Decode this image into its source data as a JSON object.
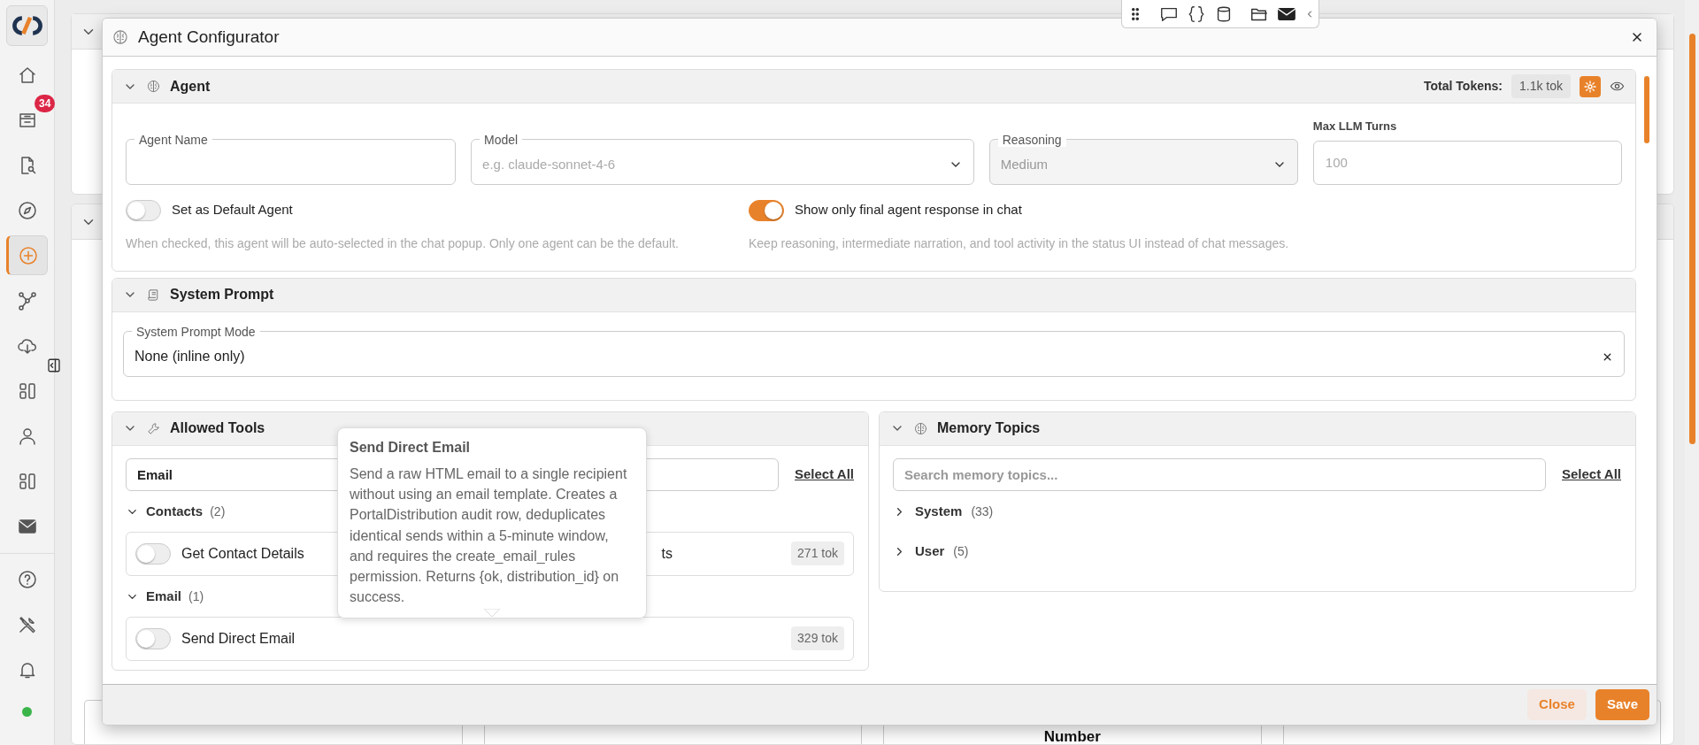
{
  "sidebar": {
    "items": [
      {
        "selected": false
      },
      {
        "selected": false,
        "badge": "34"
      },
      {
        "selected": false
      },
      {
        "selected": false
      },
      {
        "selected": true
      },
      {
        "selected": false
      },
      {
        "selected": false
      },
      {
        "selected": false
      },
      {
        "selected": false
      },
      {
        "selected": false
      },
      {
        "selected": false
      },
      {
        "selected": false
      },
      {
        "selected": false
      },
      {
        "selected": false
      }
    ]
  },
  "dialog": {
    "title": "Agent Configurator",
    "agent": {
      "title": "Agent",
      "expanded": true,
      "tokens_label": "Total Tokens:",
      "tokens": "1.1k tok",
      "fields": [
        {
          "kind": "text",
          "label": "Agent Name"
        },
        {
          "kind": "select",
          "label": "Model",
          "placeholder": "e.g. claude-sonnet-4-6"
        },
        {
          "kind": "select",
          "label": "Reasoning",
          "value": "Medium",
          "disabled": true
        },
        {
          "kind": "number",
          "label": "Max LLM Turns",
          "placeholder": "100"
        }
      ],
      "toggles": [
        {
          "label": "Set as Default Agent",
          "on": false,
          "help": "When checked, this agent will be auto-selected in the chat popup. Only one agent can be the default."
        },
        {
          "label": "Show only final agent response in chat",
          "on": true,
          "help": "Keep reasoning, intermediate narration, and tool activity in the status UI instead of chat messages."
        }
      ]
    },
    "system_prompt": {
      "title": "System Prompt",
      "expanded": true,
      "mode_label": "System Prompt Mode",
      "mode_value": "None (inline only)"
    },
    "allowed_tools": {
      "title": "Allowed Tools",
      "expanded": true,
      "search_value": "Email",
      "select_all": "Select All",
      "groups": [
        {
          "name": "Contacts",
          "count": "(2)",
          "expanded": true,
          "tools": [
            {
              "label": "Get Contact Details",
              "on": false
            },
            {
              "label": "ts",
              "tokens": "271 tok"
            }
          ]
        },
        {
          "name": "Email",
          "count": "(1)",
          "expanded": true,
          "tools": [
            {
              "label": "Send Direct Email",
              "on": false,
              "tokens": "329 tok"
            }
          ]
        }
      ]
    },
    "tooltip": {
      "title": "Send Direct Email",
      "text": "Send a raw HTML email to a single recipient without using an email template. Creates a PortalDistribution audit row, deduplicates identical sends within a 5-minute window, and requires the create_email_rules permission. Returns {ok, distribution_id} on success."
    },
    "memory_topics": {
      "title": "Memory Topics",
      "expanded": true,
      "search_placeholder": "Search memory topics...",
      "select_all": "Select All",
      "topics": [
        {
          "name": "System",
          "count": "(33)",
          "expanded": false
        },
        {
          "name": "User",
          "count": "(5)",
          "expanded": false
        }
      ]
    },
    "buttons": [
      {
        "label": "Close",
        "kind": "secondary"
      },
      {
        "label": "Save",
        "kind": "primary"
      }
    ]
  },
  "background": {
    "texts": [
      "Number"
    ]
  }
}
